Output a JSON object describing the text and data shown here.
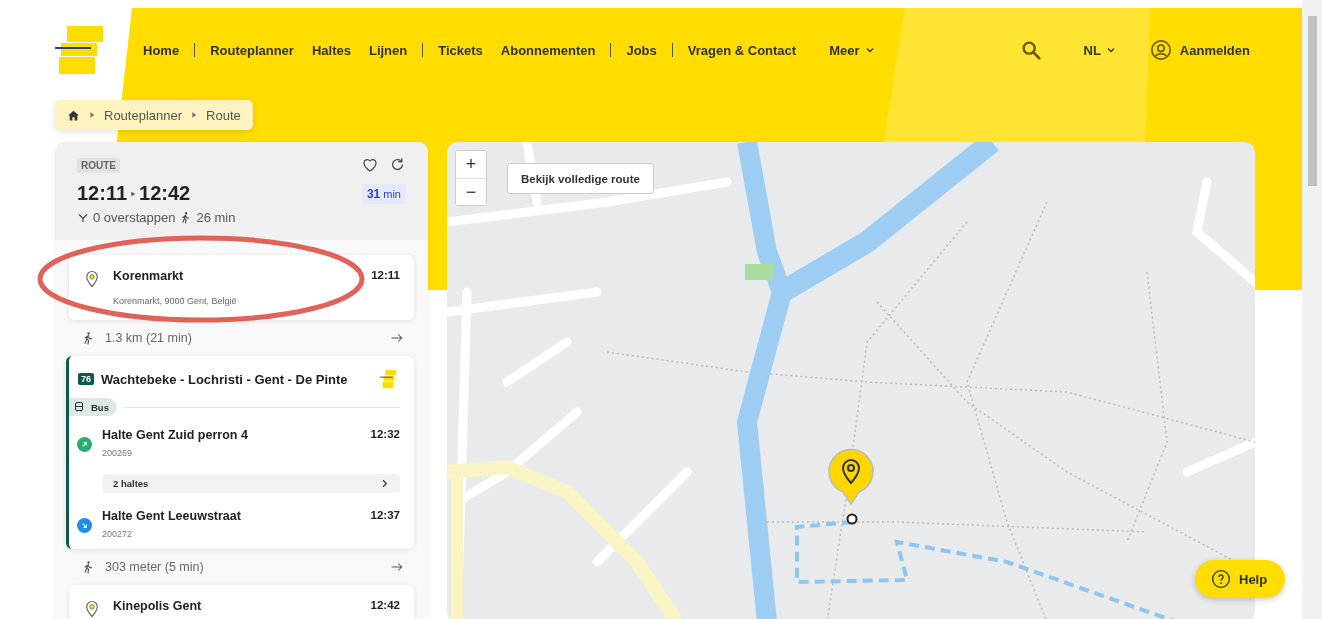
{
  "header": {
    "nav_groups": [
      [
        "Home"
      ],
      [
        "Routeplanner",
        "Haltes",
        "Lijnen"
      ],
      [
        "Tickets",
        "Abonnementen"
      ],
      [
        "Jobs"
      ],
      [
        "Vragen & Contact"
      ]
    ],
    "more": "Meer",
    "language": "NL",
    "login": "Aanmelden"
  },
  "breadcrumb": [
    "Routeplanner",
    "Route"
  ],
  "route": {
    "tag": "ROUTE",
    "depart": "12:11",
    "arrive": "12:42",
    "duration": "31",
    "duration_unit": "min",
    "transfers": "0 overstappen",
    "walk_time": "26 min"
  },
  "itinerary": [
    {
      "kind": "place",
      "name": "Korenmarkt",
      "address": "Korenmarkt, 9000 Gent, België",
      "time": "12:11"
    },
    {
      "kind": "walk",
      "text": "1.3 km (21 min)"
    },
    {
      "kind": "leg",
      "line": "76",
      "title": "Wachtebeke - Lochristi - Gent - De Pinte",
      "mode": "Bus",
      "intermediate": "2 haltes",
      "stops": [
        {
          "kind": "board",
          "name": "Halte Gent Zuid perron 4",
          "code": "200269",
          "time": "12:32",
          "color": "#2bab6b"
        },
        {
          "kind": "alight",
          "name": "Halte Gent Leeuwstraat",
          "code": "200272",
          "time": "12:37",
          "color": "#1e8fe8"
        }
      ]
    },
    {
      "kind": "walk",
      "text": "303 meter (5 min)"
    },
    {
      "kind": "place",
      "name": "Kinepolis Gent",
      "time": "12:42"
    }
  ],
  "map": {
    "zoom_in": "+",
    "zoom_out": "−",
    "full_route_button": "Bekijk volledige route"
  },
  "help": "Help"
}
